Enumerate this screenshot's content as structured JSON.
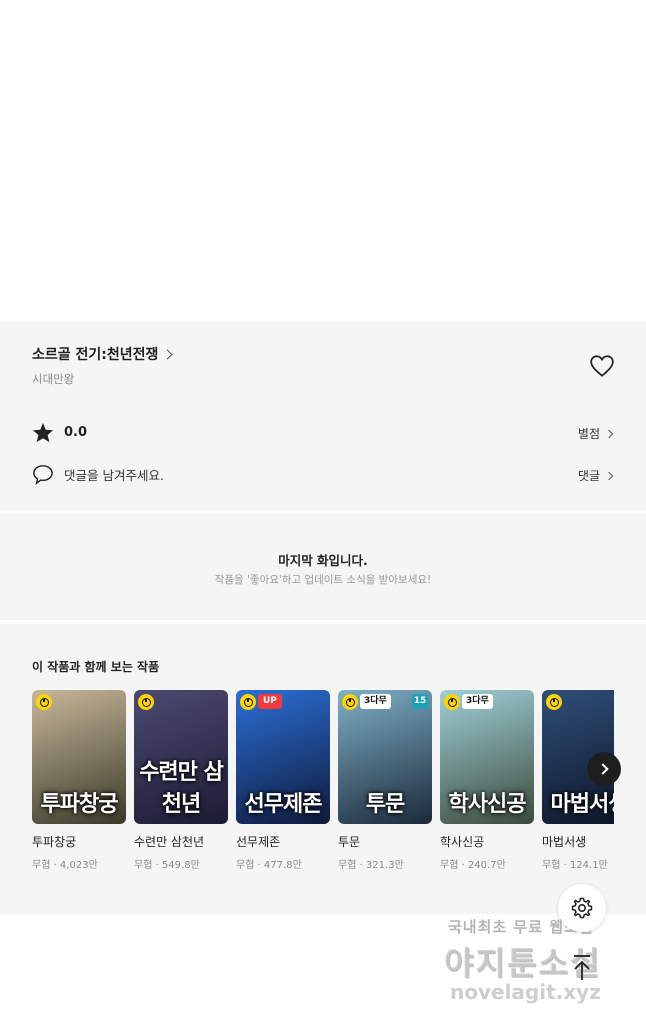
{
  "work": {
    "title": "소르골 전기:천년전쟁",
    "author": "시대만왕"
  },
  "rating": {
    "value": "0.0",
    "link_label": "별점"
  },
  "comment": {
    "prompt": "댓글을 남겨주세요.",
    "link_label": "댓글"
  },
  "last_episode": {
    "title": "마지막 화입니다.",
    "subtitle": "작품을 '좋아요'하고 업데이트 소식을 받아보세요!"
  },
  "recommendations": {
    "heading": "이 작품과 함께 보는 작품",
    "items": [
      {
        "title": "투파창궁",
        "meta": "무협 · 4,023만",
        "cover_text": "투파창궁",
        "badges": [
          "clock"
        ],
        "colors": [
          "#c9b89a",
          "#3a3a2a"
        ]
      },
      {
        "title": "수련만 삼천년",
        "meta": "무협 · 549.8만",
        "cover_text": "수련만 삼천년",
        "badges": [
          "clock"
        ],
        "colors": [
          "#4b4a72",
          "#1d1b33"
        ]
      },
      {
        "title": "선무제존",
        "meta": "무협 · 477.8만",
        "cover_text": "선무제존",
        "badges": [
          "clock",
          "UP"
        ],
        "colors": [
          "#2b6fd6",
          "#0f1a3a"
        ]
      },
      {
        "title": "투문",
        "meta": "무협 · 321.3만",
        "cover_text": "투문",
        "badges": [
          "clock",
          "3다무",
          "15"
        ],
        "colors": [
          "#7fb0c7",
          "#1b2a3a"
        ]
      },
      {
        "title": "학사신공",
        "meta": "무협 · 240.7만",
        "cover_text": "학사신공",
        "badges": [
          "clock",
          "3다무"
        ],
        "colors": [
          "#9fd0d8",
          "#3c4a3c"
        ]
      },
      {
        "title": "마법서생",
        "meta": "무협 · 124.1만",
        "cover_text": "마법서생",
        "badges": [
          "clock"
        ],
        "colors": [
          "#2f4f7a",
          "#0c1424"
        ]
      }
    ]
  },
  "watermark": {
    "line1": "국내최초 무료 웹소설",
    "line2": "야지툰소설",
    "line3": "novelagit.xyz"
  },
  "icons": {
    "heart": "heart-icon",
    "star": "star-icon",
    "comment": "speech-bubble-icon",
    "next": "chevron-right-icon",
    "settings": "gear-icon",
    "scroll_top": "arrow-up-icon"
  }
}
